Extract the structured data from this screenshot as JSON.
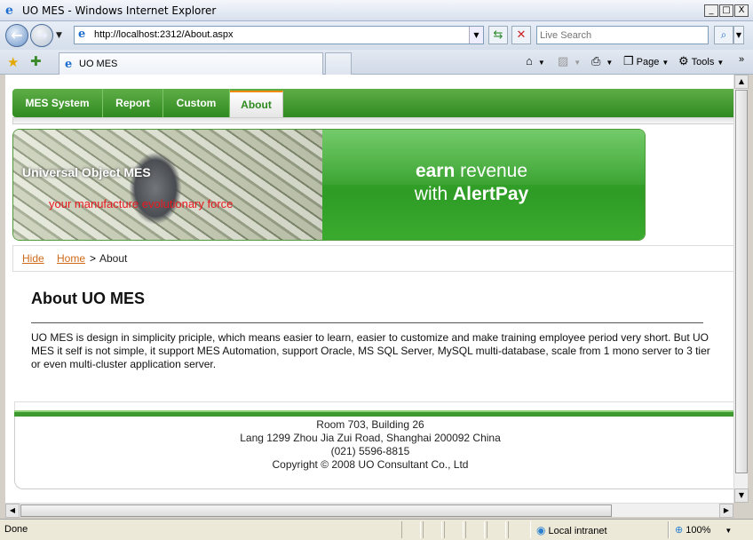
{
  "window": {
    "title": "UO MES - Windows Internet Explorer",
    "min_label": "_",
    "max_label": "□",
    "close_label": "X"
  },
  "address_bar": {
    "url": "http://localhost:2312/About.aspx"
  },
  "search": {
    "placeholder": "Live Search"
  },
  "tabs": [
    {
      "label": "UO MES"
    }
  ],
  "commands": {
    "page_label": "Page",
    "tools_label": "Tools"
  },
  "site": {
    "menu": [
      {
        "label": "MES System"
      },
      {
        "label": "Report"
      },
      {
        "label": "Custom"
      },
      {
        "label": "About",
        "active": true
      }
    ],
    "banner": {
      "title": "Universal Object MES",
      "subtitle": "your manufacture evolutionary force",
      "ad_line1_bold": "earn",
      "ad_line1_rest": " revenue",
      "ad_line2_pre": "with ",
      "ad_line2_bold": "AlertPay"
    },
    "breadcrumb": {
      "hide_label": "Hide",
      "home_label": "Home",
      "separator": ">",
      "current": "About"
    },
    "content": {
      "title": "About UO MES",
      "body": "UO MES is design in simplicity priciple, which means easier to learn, easier to customize and make training employee period very short. But UO MES it self is not simple, it support MES Automation, support Oracle, MS SQL Server, MySQL multi-database, scale from 1 mono server to 3 tier or even multi-cluster application server."
    },
    "footer": {
      "lines": [
        "Room 703, Building 26",
        "Lang 1299 Zhou Jia Zui Road, Shanghai 200092 China",
        "(021) 5596-8815",
        "Copyright © 2008 UO Consultant Co., Ltd"
      ]
    }
  },
  "status_bar": {
    "text": "Done",
    "zone": "Local intranet",
    "zoom": "100%"
  },
  "colors": {
    "menu_green": "#2f8a1f",
    "link_orange": "#d16a18",
    "banner_subtitle_red": "#e8181f"
  }
}
